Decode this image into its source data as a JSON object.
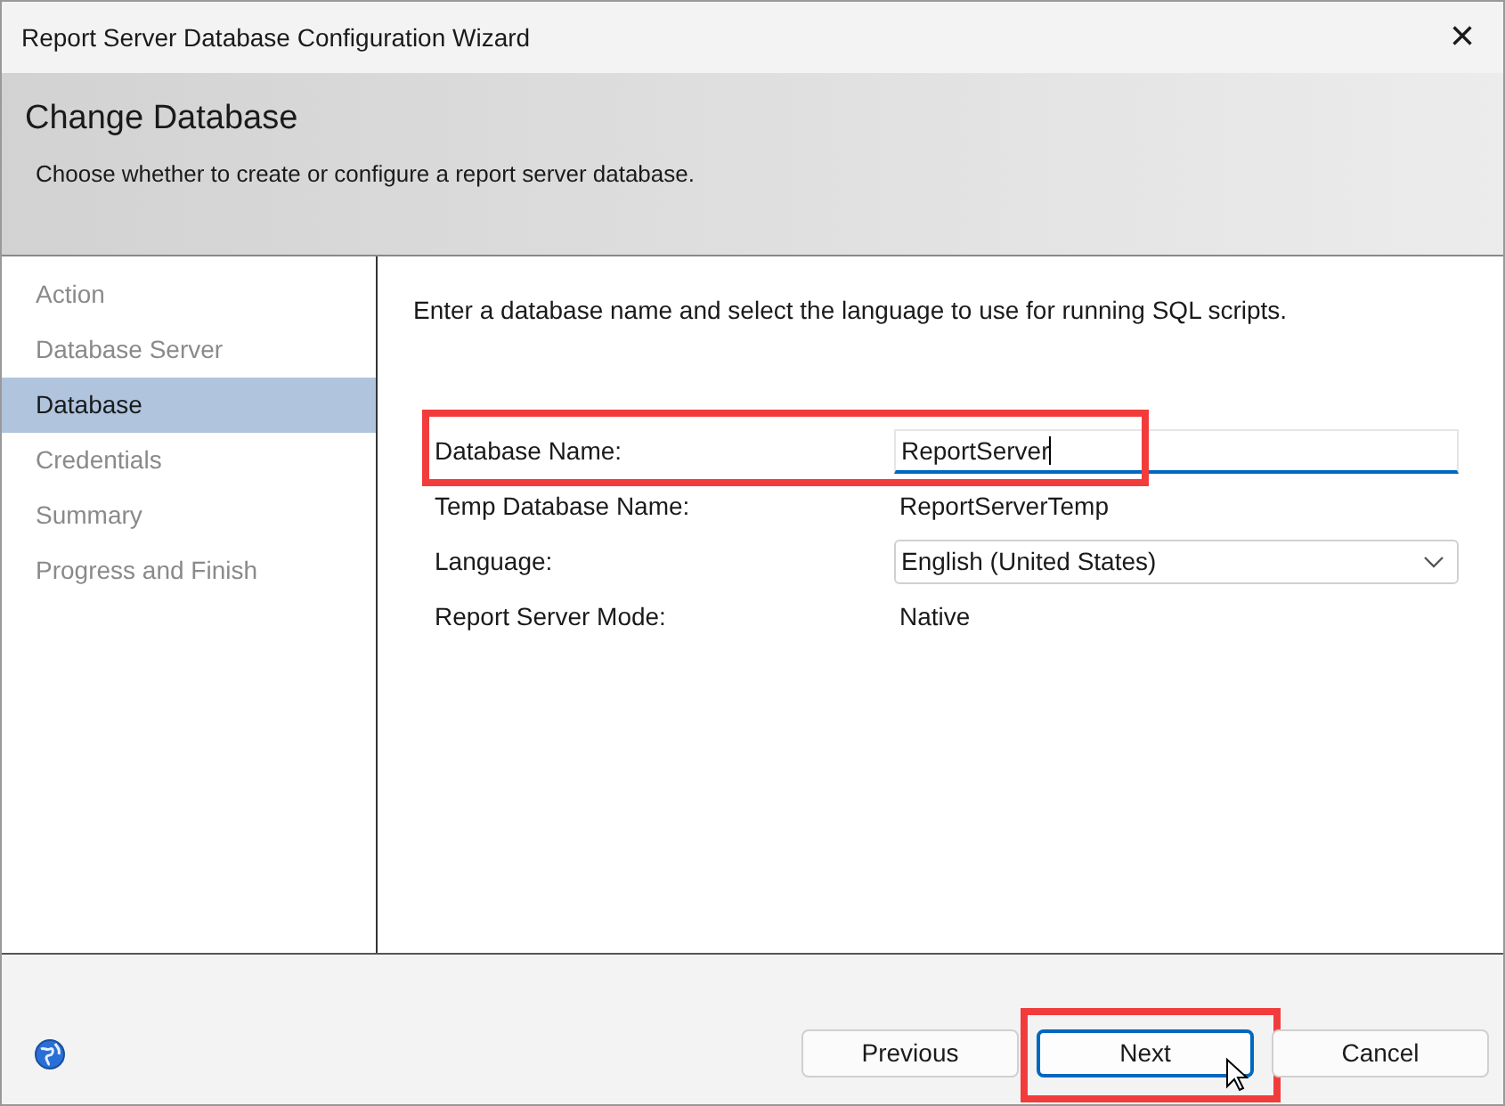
{
  "window": {
    "title": "Report Server Database Configuration Wizard",
    "close": "×"
  },
  "header": {
    "title": "Change Database",
    "subtitle": "Choose whether to create or configure a report server database."
  },
  "sidebar": {
    "items": [
      {
        "label": "Action",
        "selected": false
      },
      {
        "label": "Database Server",
        "selected": false
      },
      {
        "label": "Database",
        "selected": true
      },
      {
        "label": "Credentials",
        "selected": false
      },
      {
        "label": "Summary",
        "selected": false
      },
      {
        "label": "Progress and Finish",
        "selected": false
      }
    ]
  },
  "content": {
    "instruction": "Enter a database name and select the language to use for running SQL scripts.",
    "fields": [
      {
        "kind": "input",
        "label": "Database Name:",
        "value": "ReportServer",
        "focused": true,
        "highlighted": true
      },
      {
        "kind": "text",
        "label": "Temp Database Name:",
        "value": "ReportServerTemp",
        "highlighted": false
      },
      {
        "kind": "select",
        "label": "Language:",
        "value": "English (United States)",
        "highlighted": false
      },
      {
        "kind": "text",
        "label": "Report Server Mode:",
        "value": "Native",
        "highlighted": false
      }
    ]
  },
  "buttons": [
    {
      "label": "Previous",
      "focused": false,
      "highlighted": false
    },
    {
      "label": "Next",
      "focused": true,
      "highlighted": true
    },
    {
      "label": "Cancel",
      "focused": false,
      "highlighted": false
    }
  ]
}
